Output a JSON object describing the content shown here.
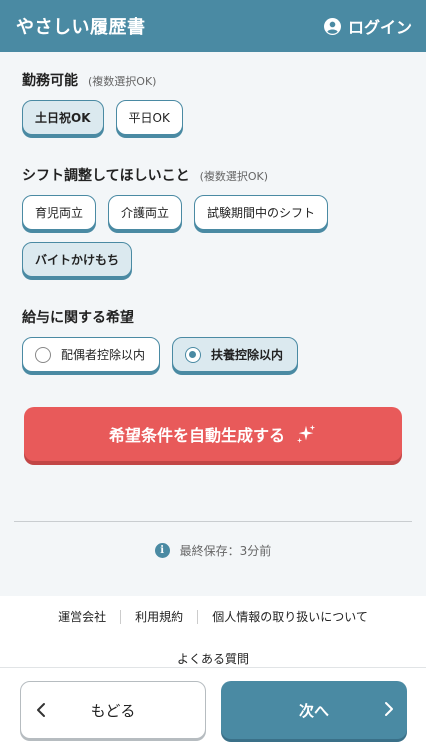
{
  "header": {
    "title": "やさしい履歴書",
    "login_label": "ログイン"
  },
  "availability": {
    "title": "勤務可能",
    "note": "(複数選択OK)",
    "options": [
      {
        "label": "土日祝OK",
        "selected": true
      },
      {
        "label": "平日OK",
        "selected": false
      }
    ]
  },
  "shift": {
    "title": "シフト調整してほしいこと",
    "note": "(複数選択OK)",
    "options": [
      {
        "label": "育児両立",
        "selected": false
      },
      {
        "label": "介護両立",
        "selected": false
      },
      {
        "label": "試験期間中のシフト",
        "selected": false
      },
      {
        "label": "バイトかけもち",
        "selected": true
      }
    ]
  },
  "salary": {
    "title": "給与に関する希望",
    "options": [
      {
        "label": "配偶者控除以内",
        "checked": false
      },
      {
        "label": "扶養控除以内",
        "checked": true
      }
    ]
  },
  "generate_button": {
    "label": "希望条件を自動生成する",
    "icon": "sparkle-icon"
  },
  "save_status": "最終保存：3分前",
  "footer": {
    "links": [
      "運営会社",
      "利用規約",
      "個人情報の取り扱いについて"
    ],
    "faq": "よくある質問"
  },
  "nav": {
    "back_label": "もどる",
    "next_label": "次へ"
  },
  "colors": {
    "primary": "#4a8aa3",
    "accent": "#e85a5a",
    "selected_bg": "#dbe9ef"
  }
}
